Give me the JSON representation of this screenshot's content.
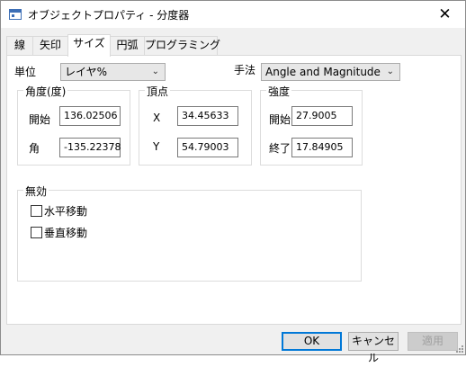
{
  "window": {
    "title": "オブジェクトプロパティ - 分度器",
    "close_symbol": "✕"
  },
  "tabs": [
    {
      "label": "線",
      "active": false
    },
    {
      "label": "矢印",
      "active": false
    },
    {
      "label": "サイズ",
      "active": true
    },
    {
      "label": "円弧",
      "active": false
    },
    {
      "label": "プログラミング",
      "active": false
    }
  ],
  "size_tab": {
    "unit_label": "単位",
    "unit_value": "レイヤ%",
    "method_label": "手法",
    "method_value": "Angle and Magnitude",
    "angle_group": {
      "title": "角度(度)",
      "rows": [
        {
          "label": "開始",
          "value": "136.02506"
        },
        {
          "label": "角",
          "value": "-135.22378"
        }
      ]
    },
    "vertex_group": {
      "title": "頂点",
      "rows": [
        {
          "label": "X",
          "value": "34.45633"
        },
        {
          "label": "Y",
          "value": "54.79003"
        }
      ]
    },
    "strength_group": {
      "title": "強度",
      "rows": [
        {
          "label": "開始",
          "value": "27.9005"
        },
        {
          "label": "終了",
          "value": "17.84905"
        }
      ]
    },
    "disable_group": {
      "title": "無効",
      "options": [
        {
          "label": "水平移動",
          "checked": false
        },
        {
          "label": "垂直移動",
          "checked": false
        }
      ]
    }
  },
  "buttons": {
    "ok": "OK",
    "cancel": "キャンセル",
    "apply": "適用"
  },
  "icons": {
    "dropdown": "chevron-down-icon",
    "close": "close-icon",
    "app": "window-app-icon"
  }
}
